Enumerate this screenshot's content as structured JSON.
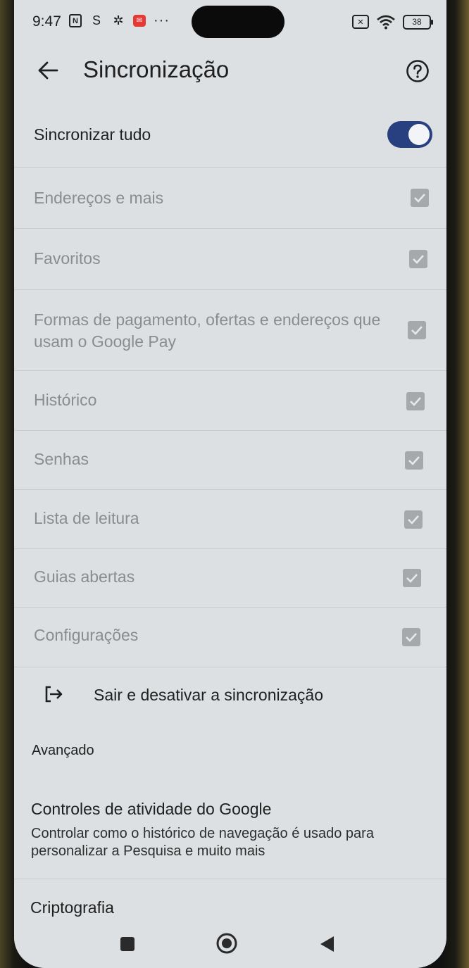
{
  "status_bar": {
    "time": "9:47",
    "icons_left": [
      "nfc-icon",
      "s-app-icon",
      "gear-icon",
      "mail-icon"
    ],
    "overflow": "···",
    "battery": "38"
  },
  "header": {
    "title": "Sincronização"
  },
  "sync_all": {
    "label": "Sincronizar tudo",
    "enabled": true
  },
  "sync_items": [
    {
      "label": "Endereços e mais",
      "checked": true
    },
    {
      "label": "Favoritos",
      "checked": true
    },
    {
      "label": "Formas de pagamento, ofertas e endereços que usam o Google Pay",
      "checked": true
    },
    {
      "label": "Histórico",
      "checked": true
    },
    {
      "label": "Senhas",
      "checked": true
    },
    {
      "label": "Lista de leitura",
      "checked": true
    },
    {
      "label": "Guias abertas",
      "checked": true
    },
    {
      "label": "Configurações",
      "checked": true
    }
  ],
  "sign_out": {
    "label": "Sair e desativar a sincronização"
  },
  "advanced": {
    "header": "Avançado",
    "activity_title": "Controles de atividade do Google",
    "activity_subtitle": "Controlar como o histórico de navegação é usado para personalizar a Pesquisa e muito mais",
    "encryption_title": "Criptografia"
  },
  "colors": {
    "toggle_on": "#28407f",
    "checkbox_disabled": "#a6a9ac",
    "background": "#dde0e2"
  }
}
